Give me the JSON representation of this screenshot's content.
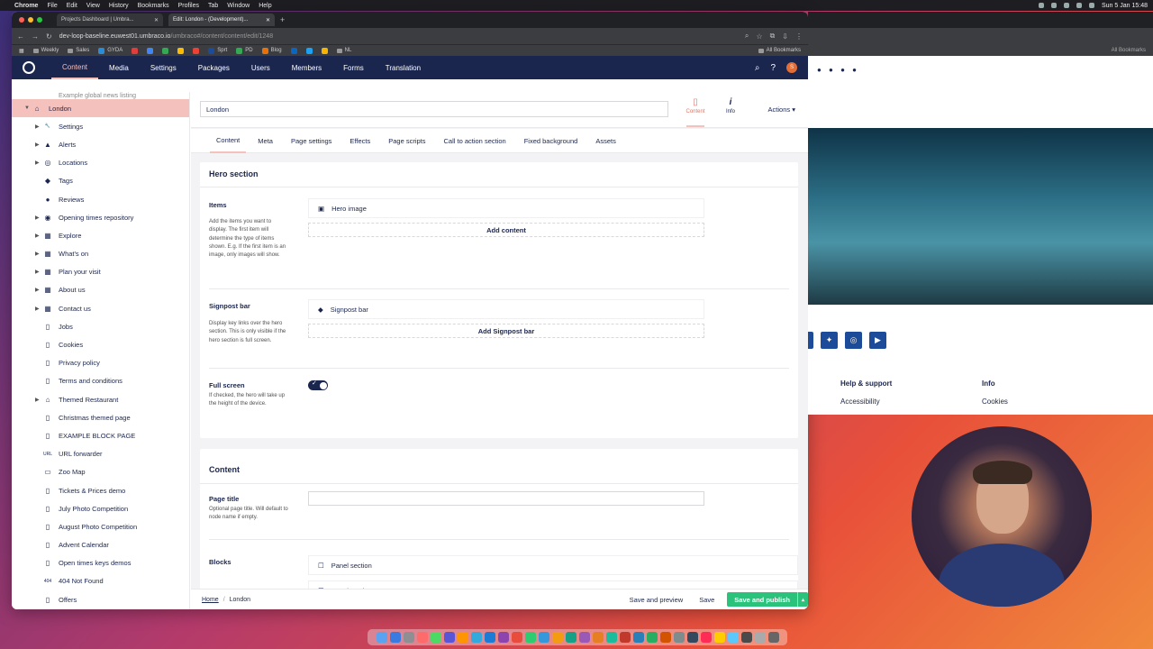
{
  "menubar": {
    "app": "Chrome",
    "items": [
      "File",
      "Edit",
      "View",
      "History",
      "Bookmarks",
      "Profiles",
      "Tab",
      "Window",
      "Help"
    ],
    "clock": "Sun 5 Jan  15:48"
  },
  "browser": {
    "tabs": [
      {
        "title": "Projects Dashboard | Umbra..."
      },
      {
        "title": "Edit: London - (Development)..."
      }
    ],
    "url_host": "dev-loop-baseline.euwest01.umbraco.io",
    "url_path": "/umbraco#/content/content/edit/1248",
    "bookmarks": [
      "Weekly",
      "Sales",
      "GYDA",
      "Sprt",
      "PD",
      "Blog",
      "NL"
    ],
    "all_bookmarks": "All Bookmarks"
  },
  "umbraco": {
    "sections": [
      "Content",
      "Media",
      "Settings",
      "Packages",
      "Users",
      "Members",
      "Forms",
      "Translation"
    ],
    "avatar_initial": "S"
  },
  "tree": {
    "partial": "Example global news listing",
    "root": "London",
    "items": [
      {
        "label": "Settings",
        "icon": "wrench-icon",
        "glyph": "🔧",
        "caret": true
      },
      {
        "label": "Alerts",
        "icon": "alert-icon",
        "glyph": "▲",
        "caret": true
      },
      {
        "label": "Locations",
        "icon": "location-icon",
        "glyph": "◎",
        "caret": true
      },
      {
        "label": "Tags",
        "icon": "tag-icon",
        "glyph": "◆",
        "caret": false
      },
      {
        "label": "Reviews",
        "icon": "comment-icon",
        "glyph": "●",
        "caret": false
      },
      {
        "label": "Opening times repository",
        "icon": "globe-icon",
        "glyph": "◉",
        "caret": true
      },
      {
        "label": "Explore",
        "icon": "grid-icon",
        "glyph": "▦",
        "caret": true
      },
      {
        "label": "What's on",
        "icon": "grid-icon",
        "glyph": "▦",
        "caret": true
      },
      {
        "label": "Plan your visit",
        "icon": "grid-icon",
        "glyph": "▦",
        "caret": true
      },
      {
        "label": "About us",
        "icon": "grid-icon",
        "glyph": "▦",
        "caret": true
      },
      {
        "label": "Contact us",
        "icon": "grid-icon",
        "glyph": "▦",
        "caret": true
      },
      {
        "label": "Jobs",
        "icon": "document-icon",
        "glyph": "▯",
        "caret": false
      },
      {
        "label": "Cookies",
        "icon": "document-icon",
        "glyph": "▯",
        "caret": false
      },
      {
        "label": "Privacy policy",
        "icon": "document-icon",
        "glyph": "▯",
        "caret": false
      },
      {
        "label": "Terms and conditions",
        "icon": "document-icon",
        "glyph": "▯",
        "caret": false
      },
      {
        "label": "Themed Restaurant",
        "icon": "home-icon",
        "glyph": "⌂",
        "caret": true
      },
      {
        "label": "Christmas themed page",
        "icon": "document-icon",
        "glyph": "▯",
        "caret": false
      },
      {
        "label": "EXAMPLE BLOCK PAGE",
        "icon": "document-icon",
        "glyph": "▯",
        "caret": false
      },
      {
        "label": "URL forwarder",
        "icon": "link-icon",
        "glyph": "URL",
        "caret": false
      },
      {
        "label": "Zoo Map",
        "icon": "map-icon",
        "glyph": "▭",
        "caret": false
      },
      {
        "label": "Tickets & Prices demo",
        "icon": "document-icon",
        "glyph": "▯",
        "caret": false
      },
      {
        "label": "July Photo Competition",
        "icon": "document-icon",
        "glyph": "▯",
        "caret": false
      },
      {
        "label": "August Photo Competition",
        "icon": "document-icon",
        "glyph": "▯",
        "caret": false
      },
      {
        "label": "Advent Calendar",
        "icon": "document-icon",
        "glyph": "▯",
        "caret": false
      },
      {
        "label": "Open times keys demos",
        "icon": "document-icon",
        "glyph": "▯",
        "caret": false
      },
      {
        "label": "404 Not Found",
        "icon": "404-icon",
        "glyph": "404",
        "caret": false
      },
      {
        "label": "Offers",
        "icon": "document-icon",
        "glyph": "▯",
        "caret": false
      }
    ]
  },
  "editor": {
    "name_value": "London",
    "apps": [
      {
        "label": "Content"
      },
      {
        "label": "Info"
      }
    ],
    "actions": "Actions",
    "tabs": [
      "Content",
      "Meta",
      "Page settings",
      "Effects",
      "Page scripts",
      "Call to action section",
      "Fixed background",
      "Assets"
    ],
    "hero": {
      "title": "Hero section",
      "items_label": "Items",
      "items_desc": "Add the items you want to display. The first item will determine the type of items shown. E.g. If the first item is an image, only images will show.",
      "items_block": "Hero image",
      "items_add": "Add content",
      "signpost_label": "Signpost bar",
      "signpost_desc": "Display key links over the hero section. This is only visible if the hero section is full screen.",
      "signpost_block": "Signpost bar",
      "signpost_add": "Add Signpost bar",
      "fullscreen_label": "Full screen",
      "fullscreen_desc": "If checked, the hero will take up the height of the device.",
      "fullscreen_on": true
    },
    "content": {
      "title": "Content",
      "page_title_label": "Page title",
      "page_title_desc": "Optional page title. Will default to node name if empty.",
      "blocks_label": "Blocks",
      "blocks": [
        "Panel section",
        "Panel section"
      ]
    }
  },
  "footer": {
    "breadcrumb": [
      "Home",
      "London"
    ],
    "save_preview": "Save and preview",
    "save": "Save",
    "publish": "Save and publish"
  },
  "preview": {
    "help_title": "Help & support",
    "help_link": "Accessibility",
    "info_title": "Info",
    "info_link": "Cookies"
  },
  "colors": {
    "umbraco_navy": "#1b264f",
    "active_pink": "#f5c1bc",
    "publish_green": "#2bc37c"
  }
}
